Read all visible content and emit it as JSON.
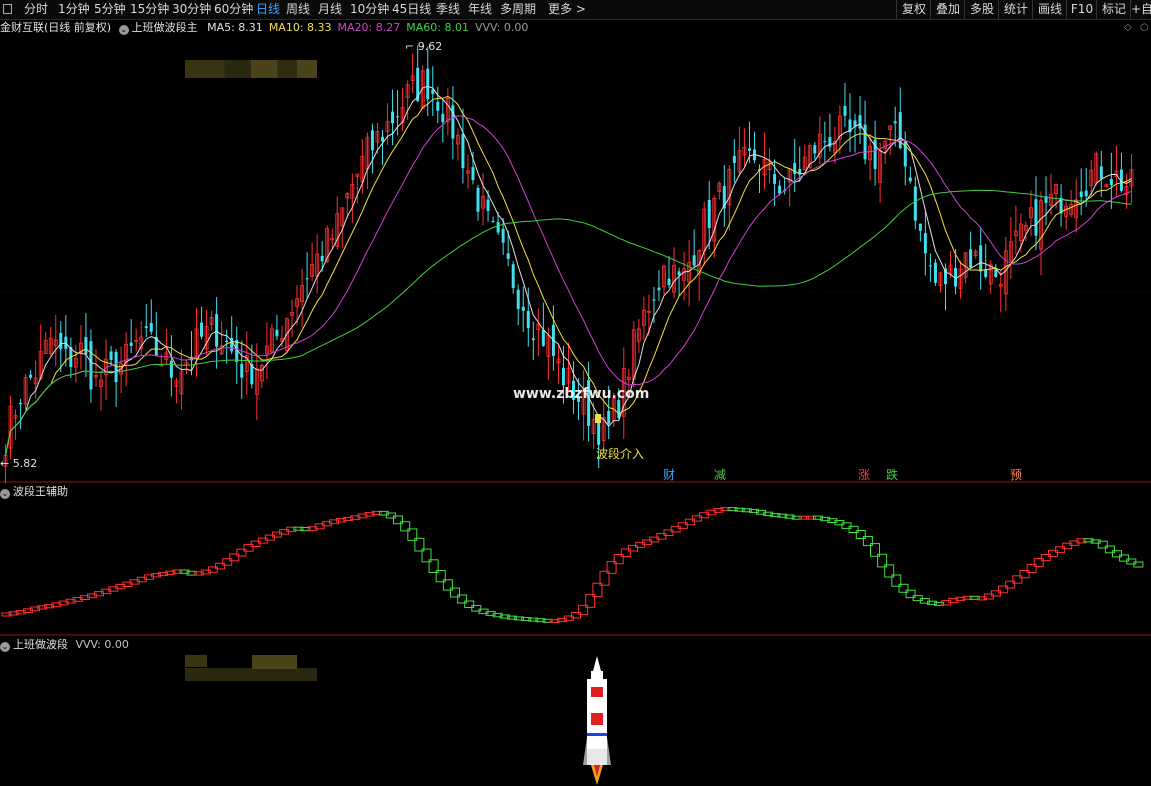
{
  "toolbar": {
    "left_items": [
      "分时",
      "1分钟",
      "5分钟",
      "15分钟",
      "30分钟",
      "60分钟",
      "日线",
      "周线",
      "月线",
      "10分钟",
      "45日线",
      "季线",
      "年线",
      "多周期",
      "更多 >"
    ],
    "active_index": 6,
    "right_items": [
      "复权",
      "叠加",
      "多股",
      "统计",
      "画线",
      "F10",
      "标记",
      "+自"
    ]
  },
  "main_panel": {
    "stock_title": "金财互联(日线 前复权)",
    "indicator_name": "上班做波段主",
    "ma_labels": [
      {
        "text": "MA5: 8.31",
        "color": "#e0e0e0"
      },
      {
        "text": "MA10: 8.33",
        "color": "#f0e040"
      },
      {
        "text": "MA20: 8.27",
        "color": "#d040d0"
      },
      {
        "text": "MA60: 8.01",
        "color": "#40d040"
      },
      {
        "text": "VVV: 0.00",
        "color": "#9a9a9a"
      }
    ],
    "high_label": "9.62",
    "low_label": "5.82",
    "entry_label": "波段介入",
    "watermark": "www.zbzfwu.com",
    "markers": [
      {
        "text": "财",
        "color": "#3ea6ff"
      },
      {
        "text": "减",
        "color": "#40d040"
      },
      {
        "text": "涨",
        "color": "#ff4040"
      },
      {
        "text": "跌",
        "color": "#40d040"
      },
      {
        "text": "预",
        "color": "#ff8040"
      }
    ]
  },
  "sub_panel_1": {
    "title": "波段王辅助"
  },
  "sub_panel_2": {
    "title": "上班做波段",
    "value_label": "VVV: 0.00"
  },
  "chart_data": {
    "type": "candlestick",
    "price_range": [
      5.82,
      9.62
    ],
    "up_color": "#ff3030",
    "down_color": "#40e0f0",
    "ma_colors": {
      "ma5": "#e0e0e0",
      "ma10": "#f0e040",
      "ma20": "#d040d0",
      "ma60": "#40d040"
    },
    "close_path": [
      6.0,
      6.4,
      6.6,
      6.9,
      6.7,
      6.8,
      6.5,
      6.6,
      6.7,
      6.9,
      6.8,
      6.6,
      6.7,
      6.9,
      7.0,
      6.8,
      6.6,
      6.7,
      6.9,
      7.2,
      7.5,
      7.7,
      7.9,
      8.3,
      8.6,
      8.8,
      9.0,
      9.2,
      9.3,
      9.1,
      8.8,
      8.4,
      8.0,
      7.7,
      7.4,
      7.1,
      6.9,
      6.6,
      6.4,
      6.2,
      6.0,
      6.4,
      6.9,
      7.3,
      7.6,
      7.4,
      7.8,
      8.1,
      8.3,
      8.5,
      8.6,
      8.4,
      8.3,
      8.5,
      8.7,
      8.8,
      8.8,
      8.7,
      8.6,
      8.8,
      8.6,
      7.8,
      7.4,
      7.5,
      7.7,
      7.6,
      7.5,
      7.7,
      7.9,
      8.1,
      8.2,
      8.3,
      8.4,
      8.5,
      8.4,
      8.3
    ],
    "oscillator_path": [
      0.1,
      0.12,
      0.15,
      0.17,
      0.2,
      0.23,
      0.26,
      0.3,
      0.34,
      0.38,
      0.42,
      0.44,
      0.46,
      0.43,
      0.46,
      0.52,
      0.6,
      0.68,
      0.73,
      0.78,
      0.82,
      0.8,
      0.85,
      0.88,
      0.9,
      0.93,
      0.95,
      0.9,
      0.78,
      0.6,
      0.42,
      0.28,
      0.18,
      0.12,
      0.09,
      0.07,
      0.06,
      0.05,
      0.04,
      0.06,
      0.12,
      0.3,
      0.5,
      0.62,
      0.68,
      0.72,
      0.78,
      0.84,
      0.9,
      0.95,
      0.98,
      0.97,
      0.96,
      0.93,
      0.92,
      0.9,
      0.91,
      0.89,
      0.86,
      0.8,
      0.7,
      0.52,
      0.35,
      0.25,
      0.2,
      0.18,
      0.22,
      0.24,
      0.23,
      0.28,
      0.36,
      0.45,
      0.55,
      0.62,
      0.68,
      0.72,
      0.7,
      0.62,
      0.55,
      0.5
    ]
  }
}
